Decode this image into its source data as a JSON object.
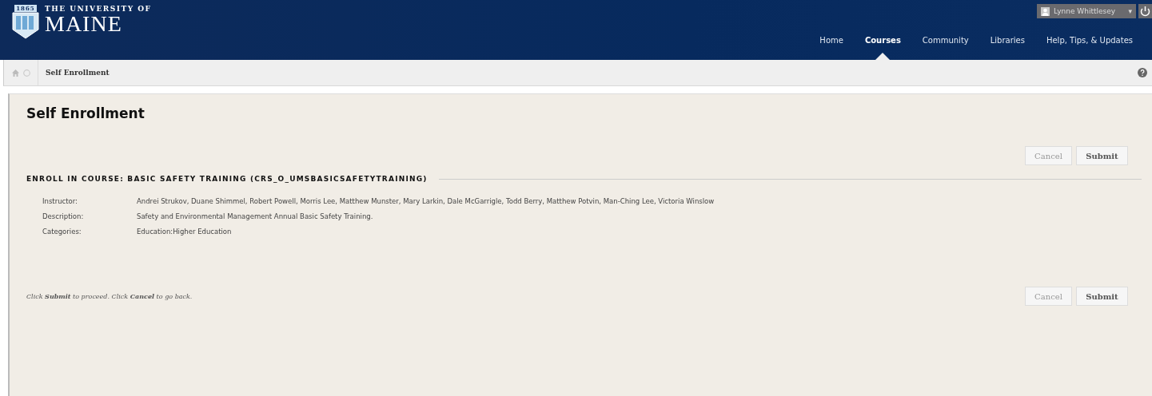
{
  "logo": {
    "year": "1865",
    "line1": "THE UNIVERSITY OF",
    "line2": "MAINE"
  },
  "user_menu": {
    "name": "Lynne Whittlesey",
    "caret": "▾"
  },
  "nav": [
    {
      "label": "Home",
      "selected": false
    },
    {
      "label": "Courses",
      "selected": true
    },
    {
      "label": "Community",
      "selected": false
    },
    {
      "label": "Libraries",
      "selected": false
    },
    {
      "label": "Help, Tips, & Updates",
      "selected": false
    }
  ],
  "breadcrumb": {
    "current": "Self Enrollment"
  },
  "page": {
    "title": "Self Enrollment",
    "top_buttons": [
      {
        "label": "Cancel",
        "kind": "secondary"
      },
      {
        "label": "Submit",
        "kind": "primary"
      }
    ],
    "section_heading": "ENROLL IN COURSE: BASIC SAFETY TRAINING (CRS_O_UMSBASICSAFETYTRAINING)",
    "details": [
      {
        "label": "Instructor:",
        "value": "Andrei Strukov, Duane Shimmel, Robert Powell, Morris Lee, Matthew Munster, Mary Larkin, Dale McGarrigle, Todd Berry, Matthew Potvin, Man-Ching Lee, Victoria Winslow"
      },
      {
        "label": "Description:",
        "value": "Safety and Environmental Management Annual Basic Safety Training."
      },
      {
        "label": "Categories:",
        "value": "Education:Higher Education"
      }
    ],
    "instructions": "Click **Submit** to proceed. Click **Cancel** to go back.",
    "bottom_buttons": [
      {
        "label": "Cancel",
        "kind": "secondary"
      },
      {
        "label": "Submit",
        "kind": "primary"
      }
    ]
  }
}
